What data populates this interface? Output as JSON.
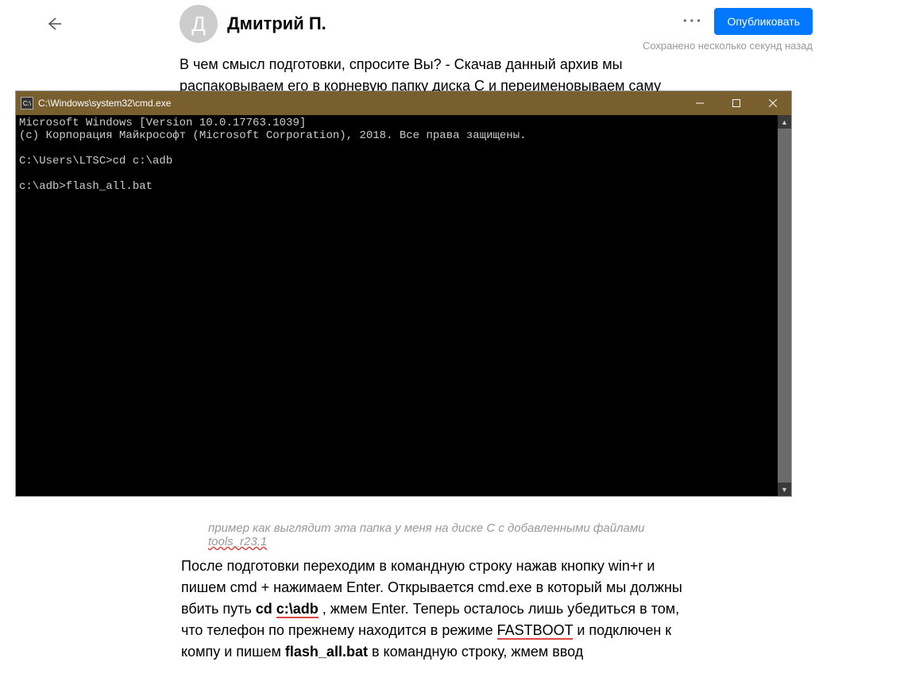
{
  "header": {
    "avatar_letter": "Д",
    "author_name": "Дмитрий П.",
    "more_label": "···",
    "publish_label": "Опубликовать",
    "save_status": "Сохранено несколько секунд назад"
  },
  "article": {
    "para1": "В чем смысл подготовки, спросите Вы? - Скачав данный архив мы распаковываем его в корневую папку диска C и переименовываем саму"
  },
  "cmd": {
    "title": "C:\\Windows\\system32\\cmd.exe",
    "lines": "Microsoft Windows [Version 10.0.17763.1039]\n(c) Корпорация Майкрософт (Microsoft Corporation), 2018. Все права защищены.\n\nC:\\Users\\LTSC>cd c:\\adb\n\nc:\\adb>flash_all.bat"
  },
  "caption": {
    "text_before": "пример как выглядит эта папка у меня на диске C с добавленными файлами ",
    "link_text": "tools_r23.1"
  },
  "bottom": {
    "t1": "После подготовки переходим в командную строку нажав кнопку win+r и пишем cmd + нажимаем Enter. Открывается cmd.exe в который мы должны вбить путь  ",
    "cd": "cd",
    "space1": " ",
    "path": "c:\\adb",
    "t2": ", жмем Enter. Теперь осталось лишь убедиться в том, что телефон по прежнему находится в режиме ",
    "fastboot": "FASTBOOT",
    "t3": " и подключен к компу и пишем  ",
    "flash": "flash_all.bat",
    "t4": " в командную строку, жмем ввод"
  }
}
